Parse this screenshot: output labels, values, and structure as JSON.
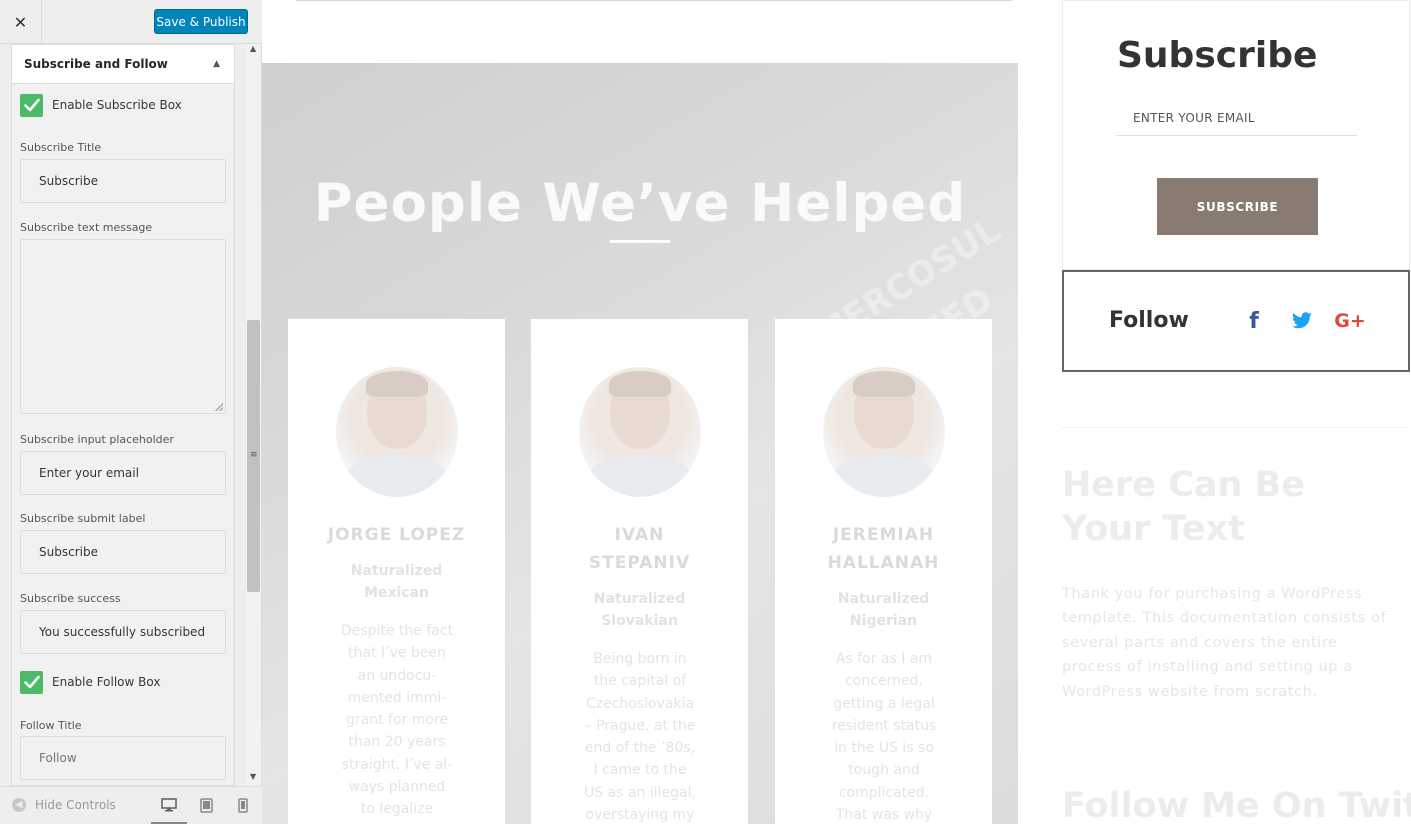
{
  "sidebar": {
    "close_label": "✕",
    "publish_label": "Save & Publish",
    "section_title": "Subscribe and Follow",
    "enable_subscribe_label": "Enable Subscribe Box",
    "subscribe_title_label": "Subscribe Title",
    "subscribe_title_value": "Subscribe",
    "subscribe_text_label": "Subscribe text message",
    "subscribe_text_value": "",
    "placeholder_label": "Subscribe input placeholder",
    "placeholder_value": "Enter your email",
    "submit_label_label": "Subscribe submit label",
    "submit_label_value": "Subscribe",
    "success_label": "Subscribe success",
    "success_value": "You successfully subscribed",
    "enable_follow_label": "Enable Follow Box",
    "follow_title_label": "Follow Title",
    "follow_title_value": "Follow",
    "hide_controls_label": "Hide Controls",
    "devices": [
      "desktop-icon",
      "tablet-icon",
      "mobile-icon"
    ]
  },
  "preview": {
    "hero_title": "People We’ve Helped",
    "hero_deco": [
      "MERCOSUL",
      "CA FED"
    ],
    "cards": [
      {
        "name_lines": [
          "JORGE LOPEZ"
        ],
        "subtitle_lines": [
          "Naturalized",
          "Mexican"
        ],
        "body_lines": [
          "Despite the fact",
          "that I’ve been",
          "an undocu-",
          "mented immi-",
          "grant for more",
          "than 20 years",
          "straight, I’ve al-",
          "ways planned",
          "to legalize"
        ]
      },
      {
        "name_lines": [
          "IVAN",
          "STEPANIV"
        ],
        "subtitle_lines": [
          "Naturalized",
          "Slovakian"
        ],
        "body_lines": [
          "Being born in",
          "the capital of",
          "Czechoslovakia",
          "– Prague, at the",
          "end of the ’80s,",
          "I came to the",
          "US as an illegal,",
          "overstaying my"
        ]
      },
      {
        "name_lines": [
          "JEREMIAH",
          "HALLANAH"
        ],
        "subtitle_lines": [
          "Naturalized",
          "Nigerian"
        ],
        "body_lines": [
          "As for as I am",
          "concerned,",
          "getting a legal",
          "resident status",
          "in the US is so",
          "tough and",
          "complicated.",
          "That was why"
        ]
      }
    ],
    "subscribe": {
      "title": "Subscribe",
      "input_placeholder": "ENTER YOUR EMAIL",
      "button": "SUBSCRIBE"
    },
    "follow": {
      "title": "Follow",
      "icons": [
        "facebook-icon",
        "twitter-icon",
        "google-plus-icon"
      ],
      "facebook_glyph": "f",
      "googleplus_glyph": "G+"
    },
    "text_widget": {
      "title": "Here Can Be Your Text",
      "body": "Thank you for purchasing a WordPress template. This documentation consists of several parts and covers the entire process of installing and setting up a WordPress website from scratch."
    },
    "twitter_title": "Follow Me On Twit-"
  },
  "colors": {
    "publish": "#0085ba",
    "checkbox": "#4cbb68",
    "subscribe_button": "#8a7b72",
    "facebook": "#3b5998",
    "twitter": "#1da1f2",
    "googleplus": "#dd4b39"
  }
}
